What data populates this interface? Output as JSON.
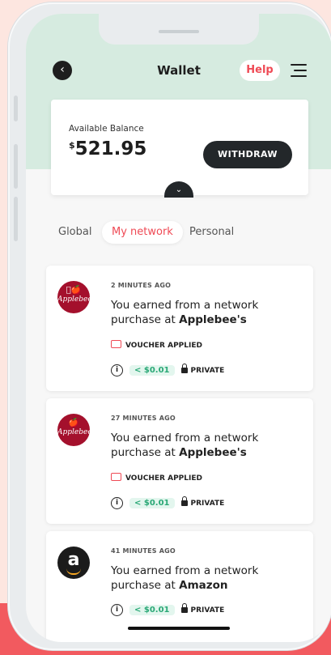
{
  "header": {
    "title": "Wallet",
    "help_label": "Help"
  },
  "balance": {
    "label": "Available Balance",
    "currency": "$",
    "amount": "521.95",
    "withdraw_label": "WITHDRAW"
  },
  "tabs": [
    {
      "label": "Global",
      "active": false
    },
    {
      "label": "My network",
      "active": true
    },
    {
      "label": "Personal",
      "active": false
    }
  ],
  "activity": [
    {
      "time": "2 MINUTES AGO",
      "message": "You earned from a network purchase at",
      "merchant": "Applebee's",
      "logo_text": "Applebee's",
      "voucher": "VOUCHER APPLIED",
      "amount": "< $0.01",
      "privacy": "PRIVATE"
    },
    {
      "time": "27 MINUTES AGO",
      "message": "You earned from a network purchase at",
      "merchant": "Applebee's",
      "logo_text": "Applebee's",
      "voucher": "VOUCHER APPLIED",
      "amount": "< $0.01",
      "privacy": "PRIVATE"
    },
    {
      "time": "41 MINUTES AGO",
      "message": "You earned from a network purchase at",
      "merchant": "Amazon",
      "logo_text": "a",
      "amount": "< $0.01",
      "privacy": "PRIVATE"
    }
  ],
  "colors": {
    "accent": "#ef4a55",
    "header_bg": "#d6ebe0",
    "dark_button": "#23272a",
    "amount_green": "#2aa876",
    "applebees_red": "#a4102c"
  }
}
